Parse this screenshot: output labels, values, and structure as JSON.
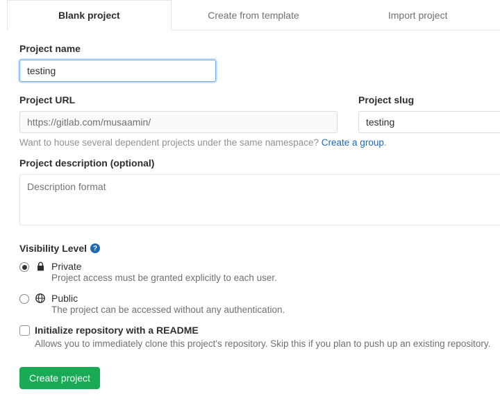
{
  "tabs": {
    "blank": "Blank project",
    "template": "Create from template",
    "import": "Import project"
  },
  "labels": {
    "project_name": "Project name",
    "project_url": "Project URL",
    "project_slug": "Project slug",
    "project_description": "Project description (optional)",
    "visibility_level": "Visibility Level"
  },
  "values": {
    "project_name": "testing",
    "project_url": "https://gitlab.com/musaamin/",
    "project_slug": "testing"
  },
  "placeholders": {
    "description": "Description format"
  },
  "hint": {
    "namespace_text": "Want to house several dependent projects under the same namespace? ",
    "create_group": "Create a group"
  },
  "visibility": {
    "private": {
      "title": "Private",
      "sub": "Project access must be granted explicitly to each user."
    },
    "public": {
      "title": "Public",
      "sub": "The project can be accessed without any authentication."
    }
  },
  "readme": {
    "label": "Initialize repository with a README",
    "sub": "Allows you to immediately clone this project's repository. Skip this if you plan to push up an existing repository."
  },
  "buttons": {
    "create_project": "Create project"
  }
}
